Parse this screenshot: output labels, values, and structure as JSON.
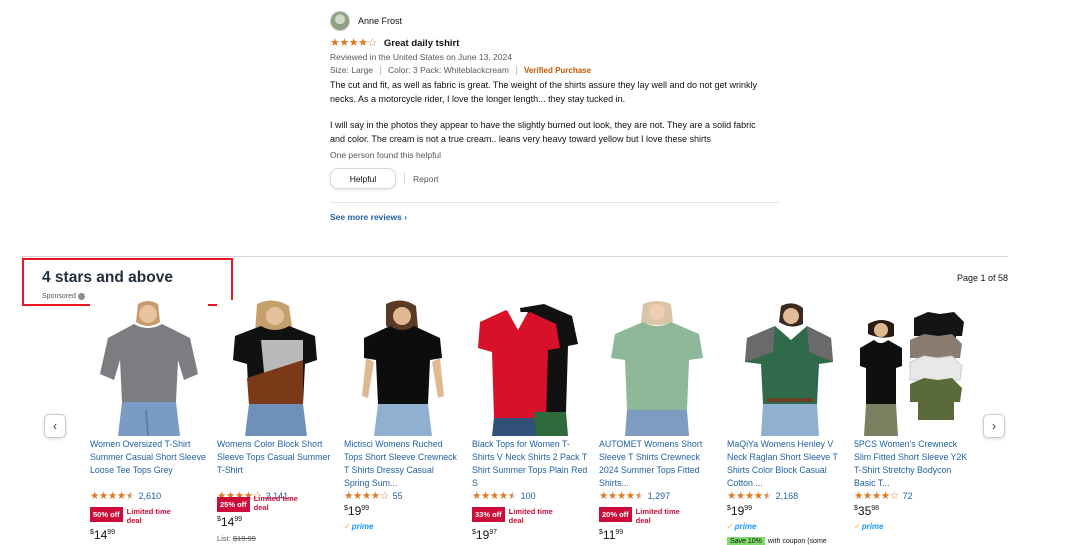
{
  "review": {
    "reviewer_name": "Anne Frost",
    "rating": 4,
    "title": "Great daily tshirt",
    "date_line": "Reviewed in the United States on June 13, 2024",
    "size": "Size: Large",
    "color": "Color: 3 Pack: Whiteblackcream",
    "verified": "Verified Purchase",
    "body_p1": "The cut and fit, as well as fabric is great. The weight of the shirts assure they lay well and do not get wrinkly necks. As a motorcycle rider, I love the longer length... they stay tucked in.",
    "body_p2": "I will say in the photos they appear to have the slightly burned out look, they are not. They are a solid fabric and color. The cream is not a true cream.. leans very heavy toward yellow but I love these shirts",
    "helpful_count": "One person found this helpful",
    "helpful_label": "Helpful",
    "report_label": "Report"
  },
  "see_more": "See more reviews",
  "carousel": {
    "title": "4 stars and above",
    "sponsored": "Sponsored",
    "page_indicator": "Page 1 of 58",
    "prev_icon": "chevron-left-icon",
    "next_icon": "chevron-right-icon"
  },
  "colors": {
    "link": "#2162a1",
    "star": "#de7921",
    "deal": "#cc0c39",
    "verified": "#c45500",
    "highlight_box": "#e8171f"
  },
  "products": [
    {
      "title": "Women Oversized T-Shirt Summer Casual Short Sleeve Loose Tee Tops Grey",
      "rating": 4.5,
      "reviews": "2,610",
      "deal_badge": "50% off",
      "deal_text": "Limited time deal",
      "price_symbol": "$",
      "price_whole": "14",
      "price_cents": "99",
      "list_price_label": "",
      "list_price": "",
      "prime": "",
      "coupon": "",
      "coupon_text": ""
    },
    {
      "title": "Womens Color Block Short Sleeve Tops Casual Summer T-Shirt",
      "rating": 4,
      "reviews": "2,141",
      "deal_badge": "25% off",
      "deal_text": "Limited time deal",
      "price_symbol": "$",
      "price_whole": "14",
      "price_cents": "99",
      "list_price_label": "List:",
      "list_price": "$19.99",
      "prime": "",
      "coupon": "",
      "coupon_text": ""
    },
    {
      "title": "Mictisci Womens Ruched Tops Short Sleeve Crewneck T Shirts Dressy Casual Spring Sum...",
      "rating": 4,
      "reviews": "55",
      "deal_badge": "",
      "deal_text": "",
      "price_symbol": "$",
      "price_whole": "19",
      "price_cents": "99",
      "list_price_label": "",
      "list_price": "",
      "prime": "prime",
      "coupon": "",
      "coupon_text": ""
    },
    {
      "title": "Black Tops for Women T-Shirts V Neck Shirts 2 Pack T Shirt Summer Tops Plain Red S",
      "rating": 4.5,
      "reviews": "100",
      "deal_badge": "33% off",
      "deal_text": "Limited time deal",
      "price_symbol": "$",
      "price_whole": "19",
      "price_cents": "97",
      "list_price_label": "",
      "list_price": "",
      "prime": "",
      "coupon": "",
      "coupon_text": ""
    },
    {
      "title": "AUTOMET Womens Short Sleeve T Shirts Crewneck 2024 Summer Tops Fitted Shirts...",
      "rating": 4.5,
      "reviews": "1,297",
      "deal_badge": "20% off",
      "deal_text": "Limited time deal",
      "price_symbol": "$",
      "price_whole": "11",
      "price_cents": "99",
      "list_price_label": "",
      "list_price": "",
      "prime": "",
      "coupon": "",
      "coupon_text": ""
    },
    {
      "title": "MaQiYa Womens Henley V Neck Raglan Short Sleeve T Shirts Color Block Casual Cotton ...",
      "rating": 4.5,
      "reviews": "2,168",
      "deal_badge": "",
      "deal_text": "",
      "price_symbol": "$",
      "price_whole": "19",
      "price_cents": "99",
      "list_price_label": "",
      "list_price": "",
      "prime": "prime",
      "coupon": "Save 10%",
      "coupon_text": "with coupon (some"
    },
    {
      "title": "5PCS Women's Crewneck Slim Fitted Short Sleeve Y2K T-Shirt Stretchy Bodycon Basic T...",
      "rating": 4,
      "reviews": "72",
      "deal_badge": "",
      "deal_text": "",
      "price_symbol": "$",
      "price_whole": "35",
      "price_cents": "98",
      "list_price_label": "",
      "list_price": "",
      "prime": "prime",
      "coupon": "",
      "coupon_text": ""
    }
  ]
}
